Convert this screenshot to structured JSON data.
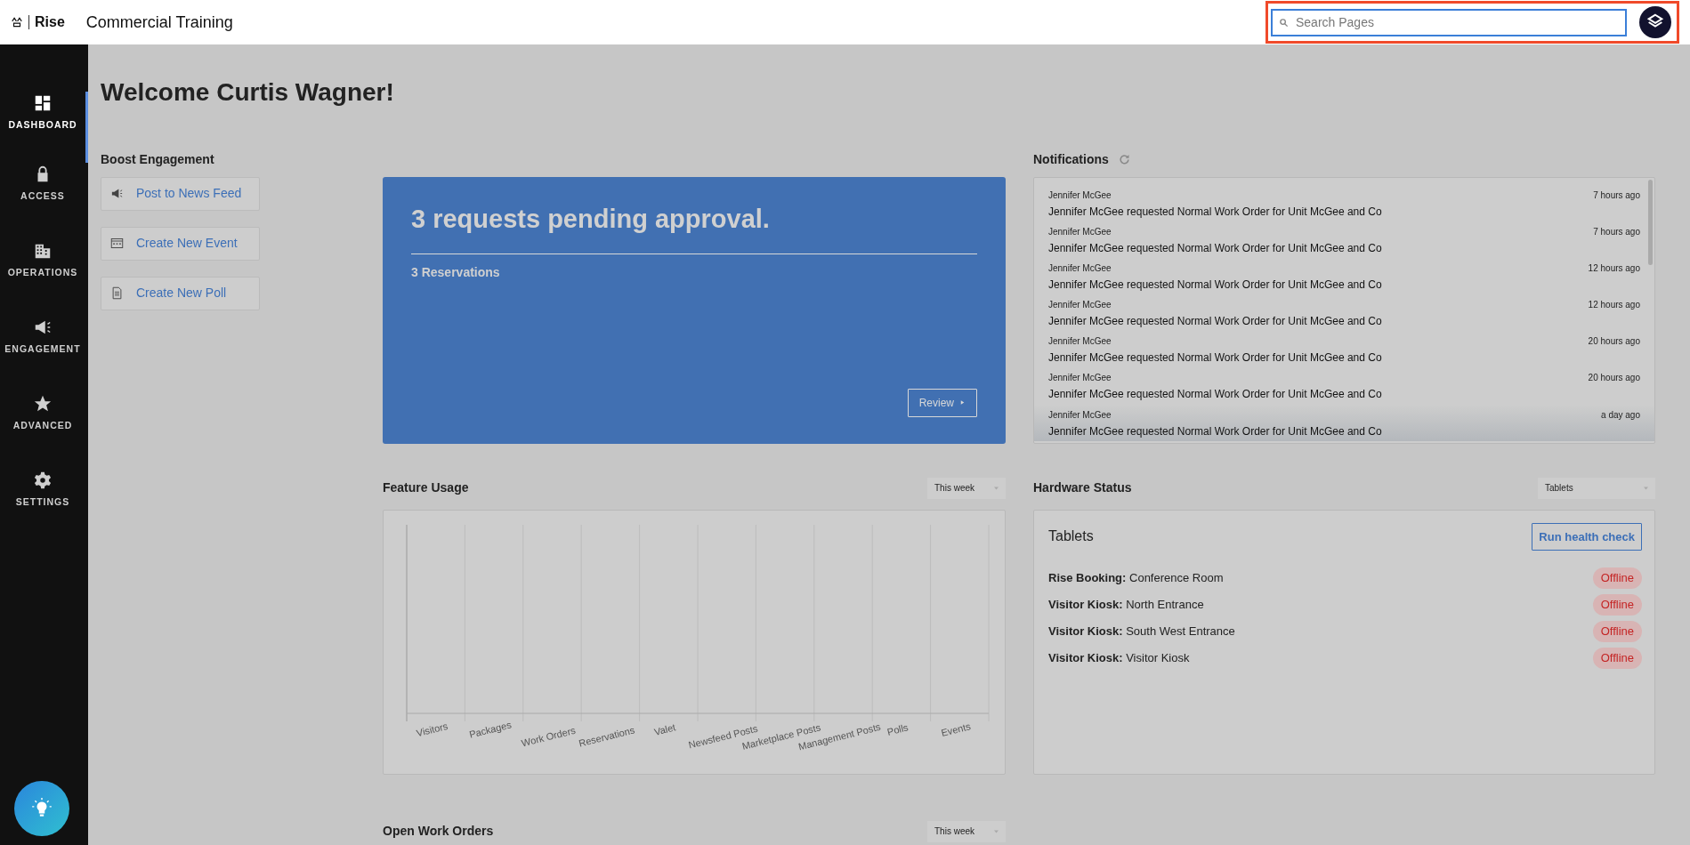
{
  "topbar": {
    "brand": "Rise",
    "title": "Commercial Training",
    "search": {
      "placeholder": "Search Pages",
      "highlighted": true
    }
  },
  "sidebar": {
    "items": [
      {
        "label": "DASHBOARD",
        "selected": true
      },
      {
        "label": "ACCESS",
        "selected": false
      },
      {
        "label": "OPERATIONS",
        "selected": false
      },
      {
        "label": "ENGAGEMENT",
        "selected": false
      },
      {
        "label": "ADVANCED",
        "selected": false
      },
      {
        "label": "SETTINGS",
        "selected": false
      }
    ]
  },
  "welcome": "Welcome Curtis Wagner!",
  "boost": {
    "title": "Boost Engagement",
    "actions": [
      {
        "label": "Post to News Feed"
      },
      {
        "label": "Create New Event"
      },
      {
        "label": "Create New Poll"
      }
    ]
  },
  "pending": {
    "title": "3 requests pending approval.",
    "items": [
      "3 Reservations"
    ],
    "button": "Review"
  },
  "notifications": {
    "title": "Notifications",
    "items": [
      {
        "author": "Jennifer McGee",
        "time": "7 hours ago",
        "text": "Jennifer McGee requested Normal Work Order for Unit McGee and Co"
      },
      {
        "author": "Jennifer McGee",
        "time": "7 hours ago",
        "text": "Jennifer McGee requested Normal Work Order for Unit McGee and Co"
      },
      {
        "author": "Jennifer McGee",
        "time": "12 hours ago",
        "text": "Jennifer McGee requested Normal Work Order for Unit McGee and Co"
      },
      {
        "author": "Jennifer McGee",
        "time": "12 hours ago",
        "text": "Jennifer McGee requested Normal Work Order for Unit McGee and Co"
      },
      {
        "author": "Jennifer McGee",
        "time": "20 hours ago",
        "text": "Jennifer McGee requested Normal Work Order for Unit McGee and Co"
      },
      {
        "author": "Jennifer McGee",
        "time": "20 hours ago",
        "text": "Jennifer McGee requested Normal Work Order for Unit McGee and Co"
      },
      {
        "author": "Jennifer McGee",
        "time": "a day ago",
        "text": "Jennifer McGee requested Normal Work Order for Unit McGee and Co"
      }
    ]
  },
  "feature_usage": {
    "title": "Feature Usage",
    "period": "This week",
    "categories": [
      "Visitors",
      "Packages",
      "Work Orders",
      "Reservations",
      "Valet",
      "Newsfeed Posts",
      "Marketplace Posts",
      "Management Posts",
      "Polls",
      "Events"
    ]
  },
  "hardware": {
    "title": "Hardware Status",
    "filter": "Tablets",
    "card_title": "Tablets",
    "button": "Run health check",
    "devices": [
      {
        "type": "Rise Booking:",
        "name": "Conference Room",
        "status": "Offline"
      },
      {
        "type": "Visitor Kiosk:",
        "name": "North Entrance",
        "status": "Offline"
      },
      {
        "type": "Visitor Kiosk:",
        "name": "South West Entrance",
        "status": "Offline"
      },
      {
        "type": "Visitor Kiosk:",
        "name": "Visitor Kiosk",
        "status": "Offline"
      }
    ]
  },
  "open_work_orders": {
    "title": "Open Work Orders",
    "period": "This week"
  }
}
